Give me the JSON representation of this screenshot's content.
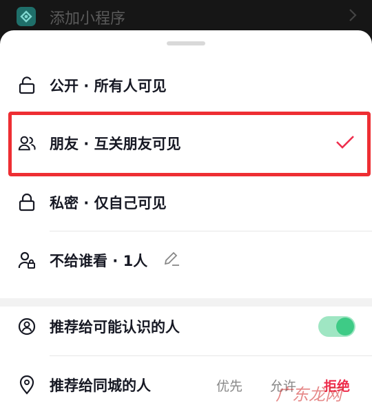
{
  "topbar": {
    "label": "添加小程序",
    "icon": "mini-program-icon",
    "chevron": "chevron-right-icon"
  },
  "visibility_options": [
    {
      "label": "公开 · 所有人可见",
      "icon": "unlock-icon",
      "selected": false
    },
    {
      "label": "朋友 · 互关朋友可见",
      "icon": "friends-icon",
      "selected": true
    },
    {
      "label": "私密 · 仅自己可见",
      "icon": "lock-icon",
      "selected": false
    },
    {
      "label": "不给谁看 · 1人",
      "icon": "person-lock-icon",
      "selected": false
    }
  ],
  "recommend": {
    "known_people": {
      "label": "推荐给可能认识的人",
      "icon": "person-circle-icon",
      "toggle_on": true
    },
    "same_city": {
      "label": "推荐给同城的人",
      "icon": "location-pin-icon",
      "options": [
        "优先",
        "允许",
        "拒绝"
      ],
      "selected": "拒绝"
    }
  },
  "watermark": "广东龙网",
  "colors": {
    "accent": "#ee2e4d",
    "toggle_on": "#3ecb86",
    "highlight_box": "#ee2e33"
  }
}
